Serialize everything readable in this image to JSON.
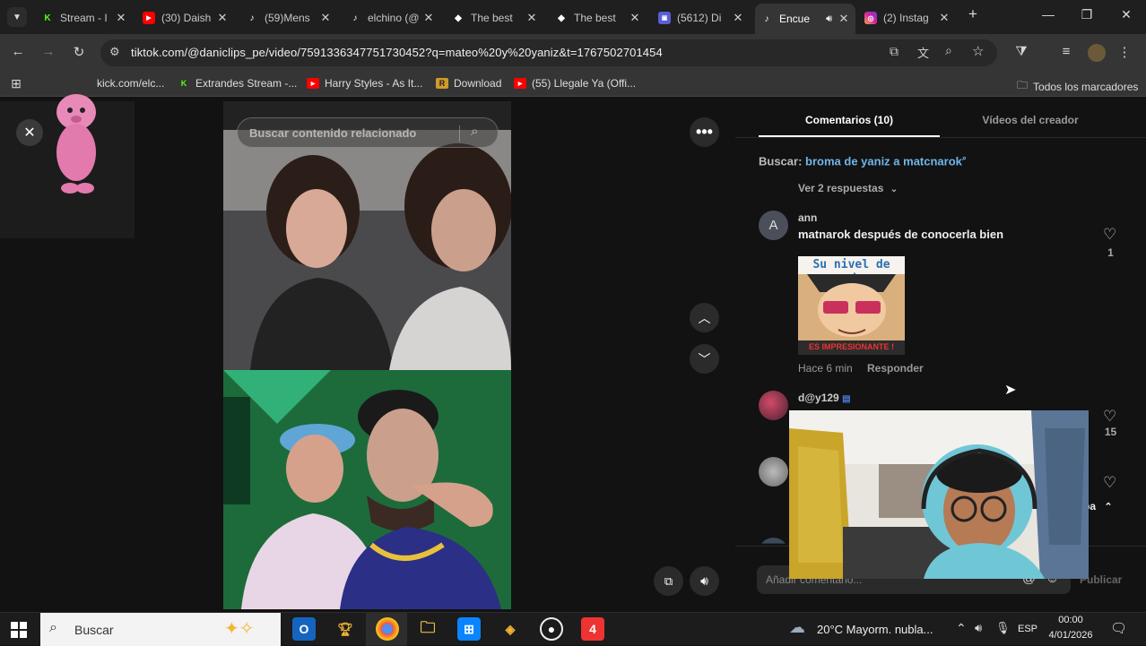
{
  "tabs": [
    {
      "title": "Stream - I",
      "icon": "kick-icon"
    },
    {
      "title": "(30) Daish",
      "icon": "youtube-icon"
    },
    {
      "title": "(59)Mens",
      "icon": "tiktok-icon"
    },
    {
      "title": "elchino (@",
      "icon": "tiktok-icon"
    },
    {
      "title": "The best",
      "icon": "diamond-icon"
    },
    {
      "title": "The best",
      "icon": "diamond-icon"
    },
    {
      "title": "(5612) Di",
      "icon": "stream-icon"
    },
    {
      "title": "Encue",
      "icon": "tiktok-icon",
      "active": true
    },
    {
      "title": "(2) Instag",
      "icon": "instagram-icon"
    }
  ],
  "address_bar": {
    "url": "tiktok.com/@daniclips_pe/video/7591336347751730452?q=mateo%20y%20yaniz&t=1767502701454"
  },
  "bookmarks": {
    "items": [
      {
        "label": "kick.com/elc..."
      },
      {
        "label": "Extrandes Stream -..."
      },
      {
        "label": "Harry Styles - As It..."
      },
      {
        "label": "Download"
      },
      {
        "label": "(55) Llegale Ya (Offi..."
      }
    ],
    "all_label": "Todos los marcadores"
  },
  "video": {
    "search_placeholder": "Buscar contenido relacionado"
  },
  "panel": {
    "tabs": [
      "Comentarios (10)",
      "Vídeos del creador"
    ],
    "search_prefix": "Buscar:",
    "search_link": "broma de yaniz a matcnarok",
    "view_replies": "Ver 2 respuestas",
    "comments": [
      {
        "avatar_letter": "A",
        "user": "ann",
        "text": "matnarok después de conocerla bien",
        "likes": "1",
        "time": "Hace 6 min",
        "reply": "Responder",
        "meme_top": "Su nivel de puta",
        "meme_bottom": "ES IMPRESIONANTE !"
      },
      {
        "user": "d@y129",
        "likes": "15"
      },
      {
        "user": ""
      }
    ],
    "scroll_label": "riba",
    "comment_placeholder": "Añadir comentario...",
    "publish_label": "Publicar"
  },
  "taskbar": {
    "search_label": "Buscar",
    "weather": "20°C  Mayorm. nubla...",
    "lang": "ESP",
    "time": "00:00",
    "date": "4/01/2026"
  },
  "colors": {
    "tiktok_link": "#6fb6e8",
    "accent_red": "#fe2c55"
  }
}
